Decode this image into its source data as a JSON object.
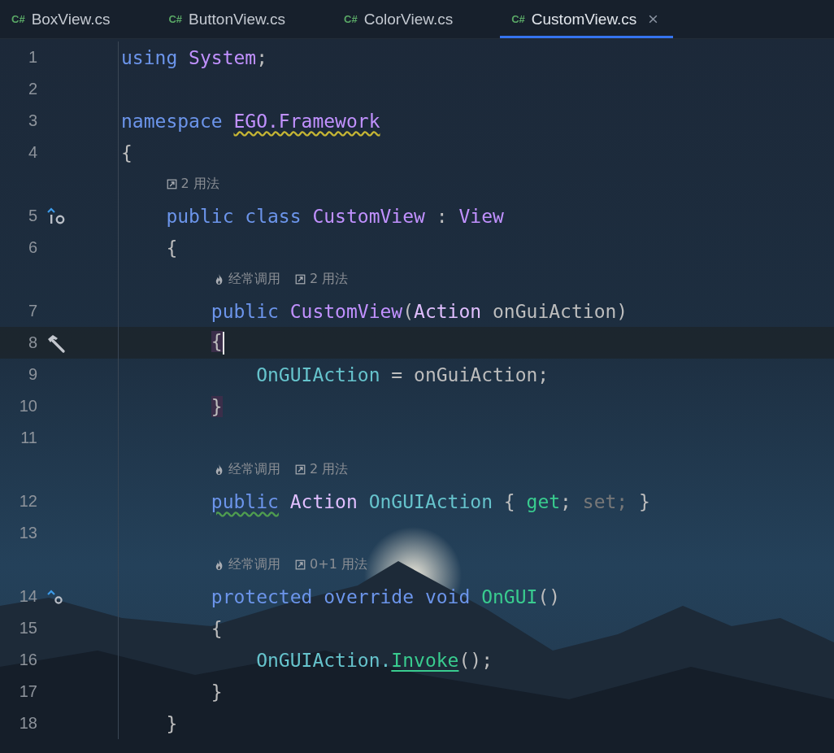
{
  "tabs": [
    {
      "icon": "C#",
      "label": "BoxView.cs",
      "selected": false,
      "closable": false
    },
    {
      "icon": "C#",
      "label": "ButtonView.cs",
      "selected": false,
      "closable": false
    },
    {
      "icon": "C#",
      "label": "ColorView.cs",
      "selected": false,
      "closable": false
    },
    {
      "icon": "C#",
      "label": "CustomView.cs",
      "selected": true,
      "closable": true
    }
  ],
  "lines": [
    {
      "kind": "code",
      "number": "1",
      "tokens": [
        {
          "text": "using ",
          "kind": "keyword"
        },
        {
          "text": "System",
          "kind": "type"
        },
        {
          "text": ";",
          "kind": "plain"
        }
      ]
    },
    {
      "kind": "code",
      "number": "2"
    },
    {
      "kind": "code",
      "number": "3",
      "tokens": [
        {
          "text": "namespace ",
          "kind": "keyword"
        },
        {
          "text": "EGO.Framework",
          "kind": "type",
          "underline": {
            "kind": "warning"
          }
        }
      ]
    },
    {
      "kind": "code",
      "number": "4",
      "tokens": [
        {
          "text": "{",
          "kind": "plain"
        }
      ]
    },
    {
      "kind": "hint",
      "items": [
        {
          "kind": "usages",
          "text": "2 用法"
        }
      ]
    },
    {
      "kind": "code",
      "number": "5",
      "gutter": {
        "kind": "implements"
      },
      "tokens": [
        {
          "text": "    public class ",
          "kind": "keyword"
        },
        {
          "text": "CustomView",
          "kind": "type"
        },
        {
          "text": " : ",
          "kind": "plain"
        },
        {
          "text": "View",
          "kind": "type"
        }
      ]
    },
    {
      "kind": "code",
      "number": "6",
      "tokens": [
        {
          "text": "    {",
          "kind": "plain"
        }
      ]
    },
    {
      "kind": "hint",
      "items": [
        {
          "kind": "frequent",
          "text": "经常调用"
        },
        {
          "kind": "usages",
          "text": "2 用法"
        }
      ]
    },
    {
      "kind": "code",
      "number": "7",
      "tokens": [
        {
          "text": "        public ",
          "kind": "keyword"
        },
        {
          "text": "CustomView",
          "kind": "type"
        },
        {
          "text": "(",
          "kind": "plain"
        },
        {
          "text": "Action",
          "kind": "struct"
        },
        {
          "text": " onGuiAction)",
          "kind": "plain"
        }
      ]
    },
    {
      "kind": "code",
      "number": "8",
      "current": true,
      "gutter": {
        "kind": "hammer"
      },
      "tokens": [
        {
          "text": "        {",
          "kind": "plain",
          "matched": true,
          "caret": true
        }
      ]
    },
    {
      "kind": "code",
      "number": "9",
      "tokens": [
        {
          "text": "            OnGUIAction",
          "kind": "property"
        },
        {
          "text": " = onGuiAction;",
          "kind": "plain"
        }
      ]
    },
    {
      "kind": "code",
      "number": "10",
      "tokens": [
        {
          "text": "        }",
          "kind": "plain",
          "matched": true
        }
      ]
    },
    {
      "kind": "code",
      "number": "11"
    },
    {
      "kind": "hint",
      "items": [
        {
          "kind": "frequent",
          "text": "经常调用"
        },
        {
          "kind": "usages",
          "text": "2 用法"
        }
      ]
    },
    {
      "kind": "code",
      "number": "12",
      "tokens": [
        {
          "text": "        public",
          "kind": "keyword",
          "underline": {
            "kind": "suggestion"
          }
        },
        {
          "text": " Action ",
          "kind": "struct"
        },
        {
          "text": "OnGUIAction",
          "kind": "property"
        },
        {
          "text": " { ",
          "kind": "plain"
        },
        {
          "text": "get",
          "kind": "method"
        },
        {
          "text": "; ",
          "kind": "plain"
        },
        {
          "text": "set;",
          "kind": "unused"
        },
        {
          "text": " }",
          "kind": "plain"
        }
      ]
    },
    {
      "kind": "code",
      "number": "13"
    },
    {
      "kind": "hint",
      "items": [
        {
          "kind": "frequent",
          "text": "经常调用"
        },
        {
          "kind": "usages",
          "text": "0+1 用法"
        }
      ]
    },
    {
      "kind": "code",
      "number": "14",
      "gutter": {
        "kind": "overrides"
      },
      "tokens": [
        {
          "text": "        protected override void ",
          "kind": "keyword"
        },
        {
          "text": "OnGUI",
          "kind": "method"
        },
        {
          "text": "()",
          "kind": "plain"
        }
      ]
    },
    {
      "kind": "code",
      "number": "15",
      "tokens": [
        {
          "text": "        {",
          "kind": "plain"
        }
      ]
    },
    {
      "kind": "code",
      "number": "16",
      "tokens": [
        {
          "text": "            OnGUIAction.",
          "kind": "property"
        },
        {
          "text": "Invoke",
          "kind": "method",
          "underline": {
            "kind": "link"
          }
        },
        {
          "text": "();",
          "kind": "plain"
        }
      ]
    },
    {
      "kind": "code",
      "number": "17",
      "tokens": [
        {
          "text": "        }",
          "kind": "plain"
        }
      ]
    },
    {
      "kind": "code",
      "number": "18",
      "tokens": [
        {
          "text": "    }",
          "kind": "plain"
        }
      ]
    }
  ]
}
